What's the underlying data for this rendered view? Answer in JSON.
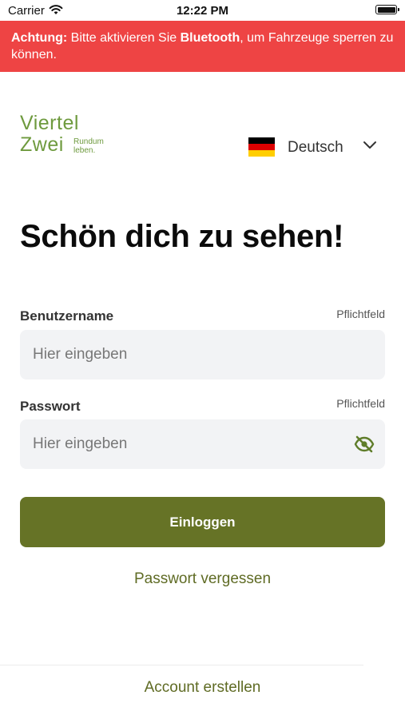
{
  "status_bar": {
    "carrier": "Carrier",
    "time": "12:22 PM"
  },
  "banner": {
    "prefix": "Achtung:",
    "part1": " Bitte aktivieren Sie ",
    "highlight": "Bluetooth",
    "part2": ", um Fahrzeuge sperren zu können."
  },
  "logo": {
    "line1": "Viertel",
    "line2": "Zwei",
    "tagline1": "Rundum",
    "tagline2": "leben."
  },
  "language": {
    "label": "Deutsch",
    "flag_colors": [
      "#000000",
      "#dd0000",
      "#ffce00"
    ]
  },
  "heading": "Schön dich zu sehen!",
  "username": {
    "label": "Benutzername",
    "required": "Pflichtfeld",
    "placeholder": "Hier eingeben",
    "value": ""
  },
  "password": {
    "label": "Passwort",
    "required": "Pflichtfeld",
    "placeholder": "Hier eingeben",
    "value": ""
  },
  "login_button": "Einloggen",
  "forgot_password": "Passwort vergessen",
  "create_account": "Account erstellen",
  "colors": {
    "banner": "#ee4444",
    "brand_green": "#6e9a3e",
    "button": "#667326",
    "link": "#5f6b24"
  }
}
